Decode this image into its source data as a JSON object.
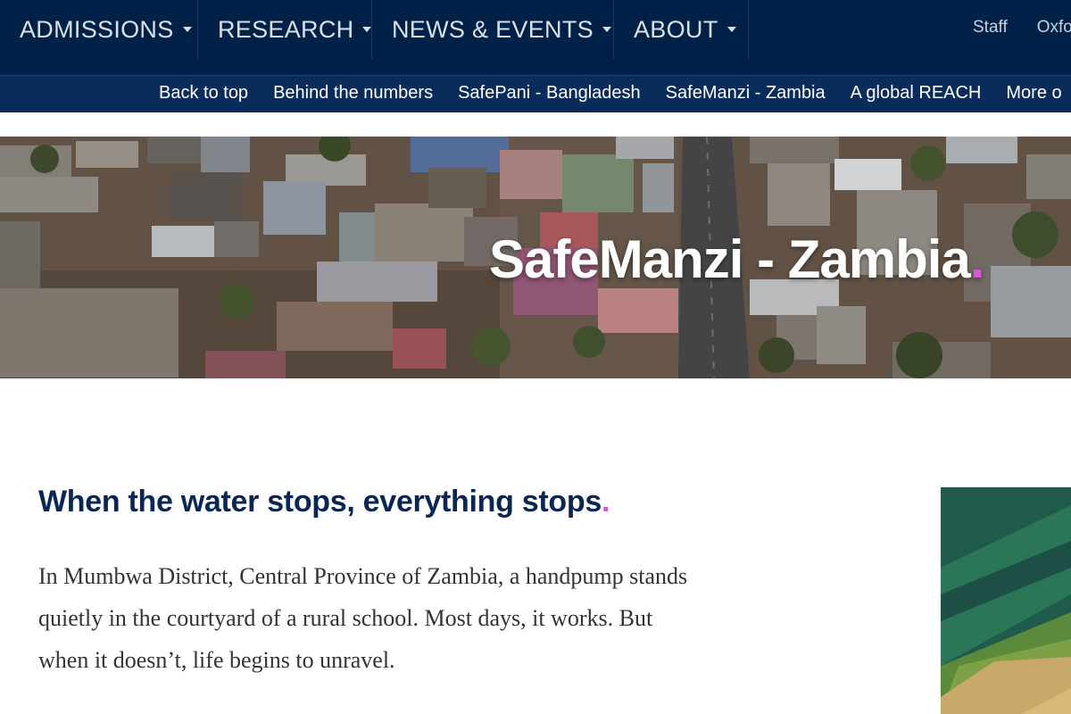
{
  "topnav": {
    "items": [
      {
        "label": "ADMISSIONS"
      },
      {
        "label": "RESEARCH"
      },
      {
        "label": "NEWS & EVENTS"
      },
      {
        "label": "ABOUT"
      }
    ],
    "links": [
      {
        "label": "Staff"
      },
      {
        "label": "Oxfo"
      }
    ]
  },
  "subnav": {
    "links": [
      {
        "label": "Back to top"
      },
      {
        "label": "Behind the numbers"
      },
      {
        "label": "SafePani - Bangladesh"
      },
      {
        "label": "SafeManzi - Zambia"
      },
      {
        "label": "A global REACH"
      },
      {
        "label": "More o"
      }
    ]
  },
  "hero": {
    "title": "SafeManzi - Zambia",
    "title_dot": "."
  },
  "article": {
    "heading": "When the water stops, everything stops",
    "heading_dot": ".",
    "paragraph": "In Mumbwa District, Central Province of Zambia, a handpump stands quietly in the courtyard of a rural school. Most days, it works. But when it doesn’t, life begins to unravel."
  },
  "colors": {
    "navy": "#002147",
    "subnav": "#0a2c5a",
    "accent_dot": "#d45ad0",
    "heading": "#0a2655"
  }
}
